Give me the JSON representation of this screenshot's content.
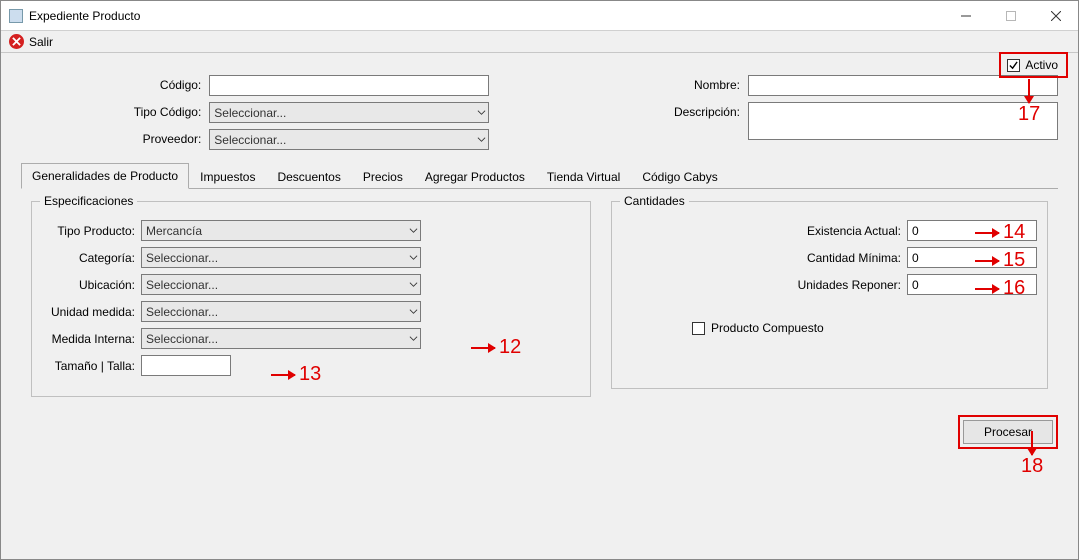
{
  "window": {
    "title": "Expediente Producto"
  },
  "toolbar": {
    "salir": "Salir"
  },
  "active": {
    "label": "Activo",
    "checked": true
  },
  "form": {
    "codigo_label": "Código:",
    "codigo_value": "",
    "tipo_codigo_label": "Tipo Código:",
    "tipo_codigo_value": "Seleccionar...",
    "proveedor_label": "Proveedor:",
    "proveedor_value": "Seleccionar...",
    "nombre_label": "Nombre:",
    "nombre_value": "",
    "descripcion_label": "Descripción:",
    "descripcion_value": ""
  },
  "tabs": [
    {
      "label": "Generalidades de Producto",
      "active": true
    },
    {
      "label": "Impuestos"
    },
    {
      "label": "Descuentos"
    },
    {
      "label": "Precios"
    },
    {
      "label": "Agregar Productos"
    },
    {
      "label": "Tienda Virtual"
    },
    {
      "label": "Código Cabys"
    }
  ],
  "spec": {
    "legend": "Especificaciones",
    "tipo_producto_label": "Tipo Producto:",
    "tipo_producto_value": "Mercancía",
    "categoria_label": "Categoría:",
    "categoria_value": "Seleccionar...",
    "ubicacion_label": "Ubicación:",
    "ubicacion_value": "Seleccionar...",
    "unidad_medida_label": "Unidad medida:",
    "unidad_medida_value": "Seleccionar...",
    "medida_interna_label": "Medida Interna:",
    "medida_interna_value": "Seleccionar...",
    "tamano_label": "Tamaño | Talla:",
    "tamano_value": ""
  },
  "qty": {
    "legend": "Cantidades",
    "existencia_label": "Existencia Actual:",
    "existencia_value": "0",
    "minima_label": "Cantidad Mínima:",
    "minima_value": "0",
    "reponer_label": "Unidades Reponer:",
    "reponer_value": "0",
    "compuesto_label": "Producto Compuesto",
    "compuesto_checked": false
  },
  "procesar_label": "Procesar",
  "annotations": {
    "a12": "12",
    "a13": "13",
    "a14": "14",
    "a15": "15",
    "a16": "16",
    "a17": "17",
    "a18": "18"
  }
}
